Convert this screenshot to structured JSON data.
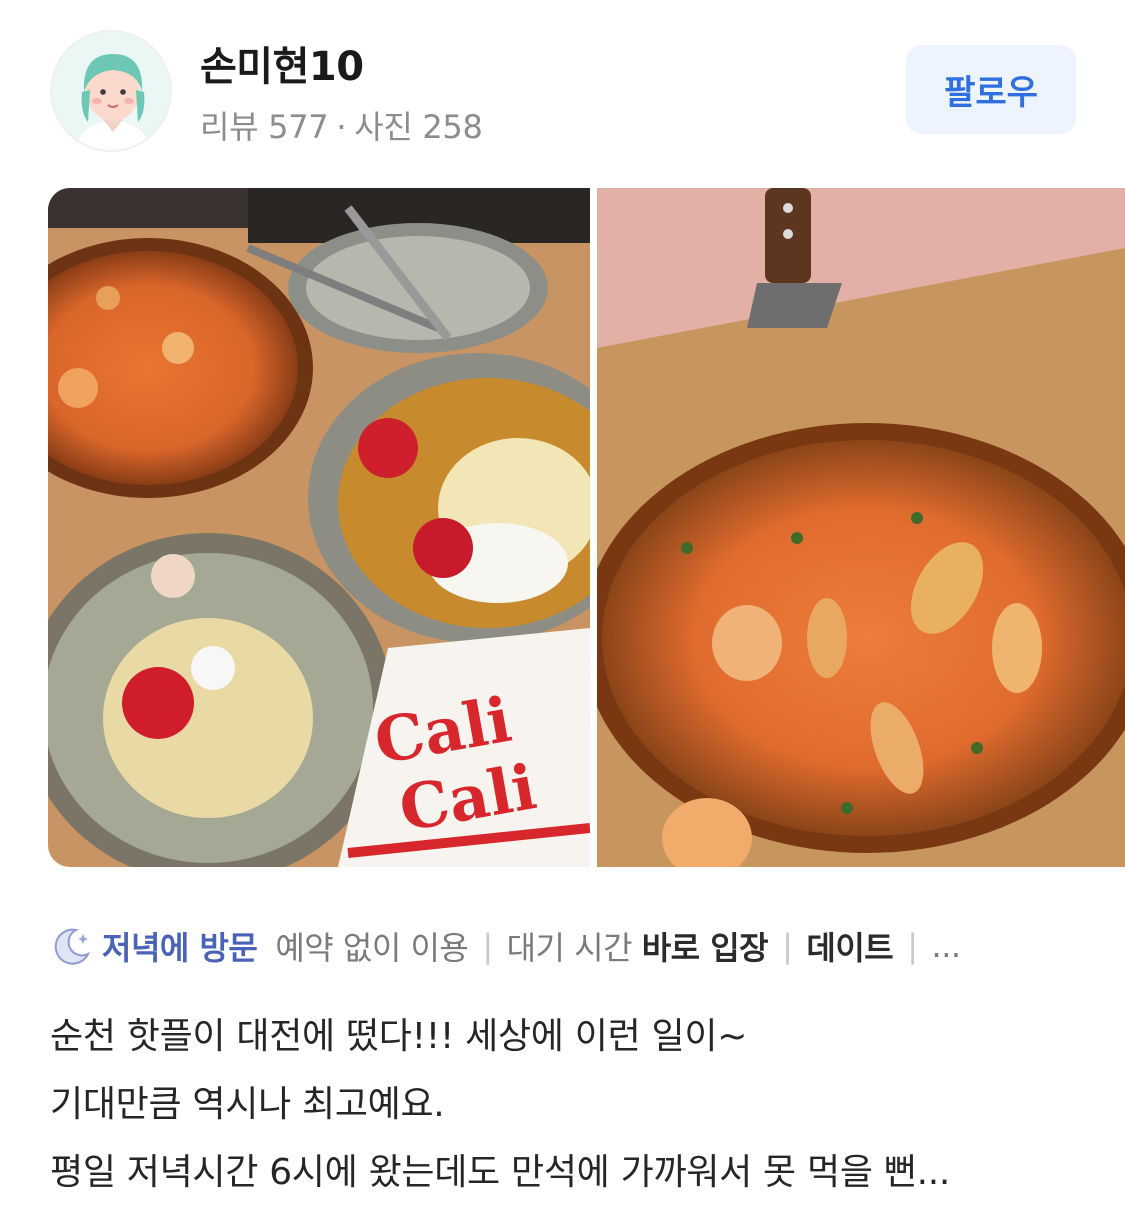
{
  "profile": {
    "name": "손미현10",
    "reviews_label": "리뷰",
    "reviews_count": "577",
    "photos_label": "사진",
    "photos_count": "258",
    "separator": "·"
  },
  "follow_button": {
    "label": "팔로우",
    "color": "#2f6fe0",
    "bg": "#eef4fd"
  },
  "photos": [
    {
      "name": "pizza-pasta-table-photo",
      "napkin_text_1": "Cali",
      "napkin_text_2": "Cali"
    },
    {
      "name": "pizza-closeup-photo"
    }
  ],
  "tags": {
    "visit_icon": "moon-icon",
    "visit": "저녁에 방문",
    "reservation": "예약 없이 이용",
    "wait_key": "대기 시간",
    "wait_value": "바로 입장",
    "purpose": "데이트",
    "divider": "|",
    "more": "..."
  },
  "review_lines": [
    "순천 핫플이 대전에 떴다!!! 세상에 이런 일이~",
    "기대만큼 역시나 최고예요.",
    "평일 저녁시간 6시에 왔는데도 만석에 가까워서 못 먹을 뻔..."
  ]
}
